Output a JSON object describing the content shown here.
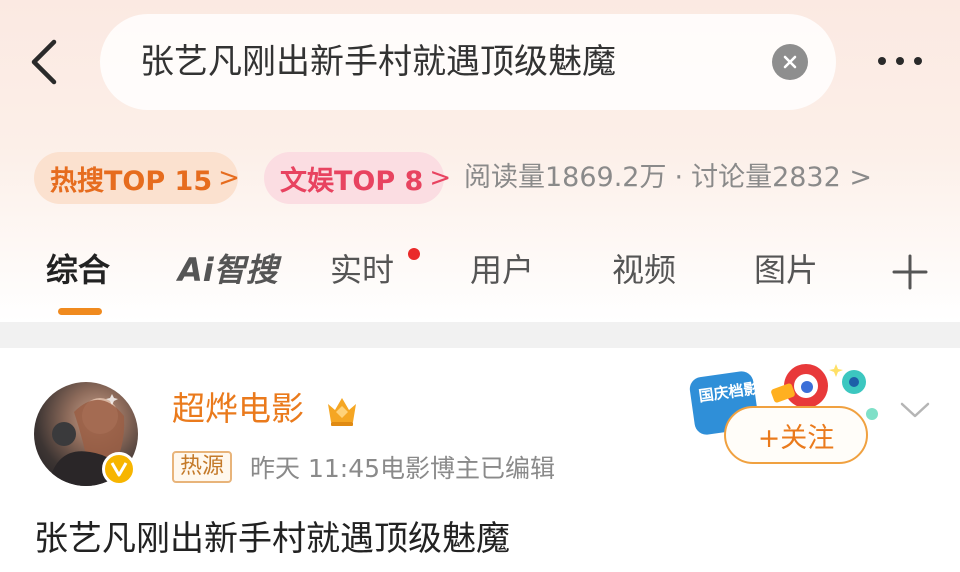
{
  "search": {
    "query": "张艺凡刚出新手村就遇顶级魅魔"
  },
  "rank_badges": {
    "hot_search": {
      "label": "热搜TOP 15",
      "chevron": ">"
    },
    "entertainment": {
      "label": "文娱TOP 8",
      "chevron": ">"
    }
  },
  "stats": {
    "reads": "阅读量1869.2万",
    "separator": "·",
    "discussions": "讨论量2832",
    "chevron": ">"
  },
  "tabs": [
    {
      "label": "综合",
      "active": true
    },
    {
      "label": "Ai智搜",
      "active": false
    },
    {
      "label": "实时",
      "active": false,
      "has_new_dot": true
    },
    {
      "label": "用户",
      "active": false
    },
    {
      "label": "视频",
      "active": false
    },
    {
      "label": "图片",
      "active": false
    }
  ],
  "post": {
    "author": "超烨电影",
    "source_tag": "热源",
    "time": "昨天 11:45",
    "role": "电影博主",
    "edited": "已编辑",
    "follow_label": "+关注",
    "promo_text": "国庆档影评计",
    "text": "张艺凡刚出新手村就遇顶级魅魔"
  },
  "icons": {
    "back": "chevron-left-icon",
    "clear": "clear-icon",
    "more": "more-icon",
    "add_tab": "plus-icon",
    "verified": "verified-badge-icon",
    "crown": "crown-icon",
    "dropdown": "chevron-down-icon"
  },
  "colors": {
    "accent_orange": "#ea7a1c",
    "hot_search_text": "#e66c1e",
    "entertainment_text": "#e84360",
    "tab_underline": "#f08a1e",
    "new_dot": "#ea2a2a"
  }
}
